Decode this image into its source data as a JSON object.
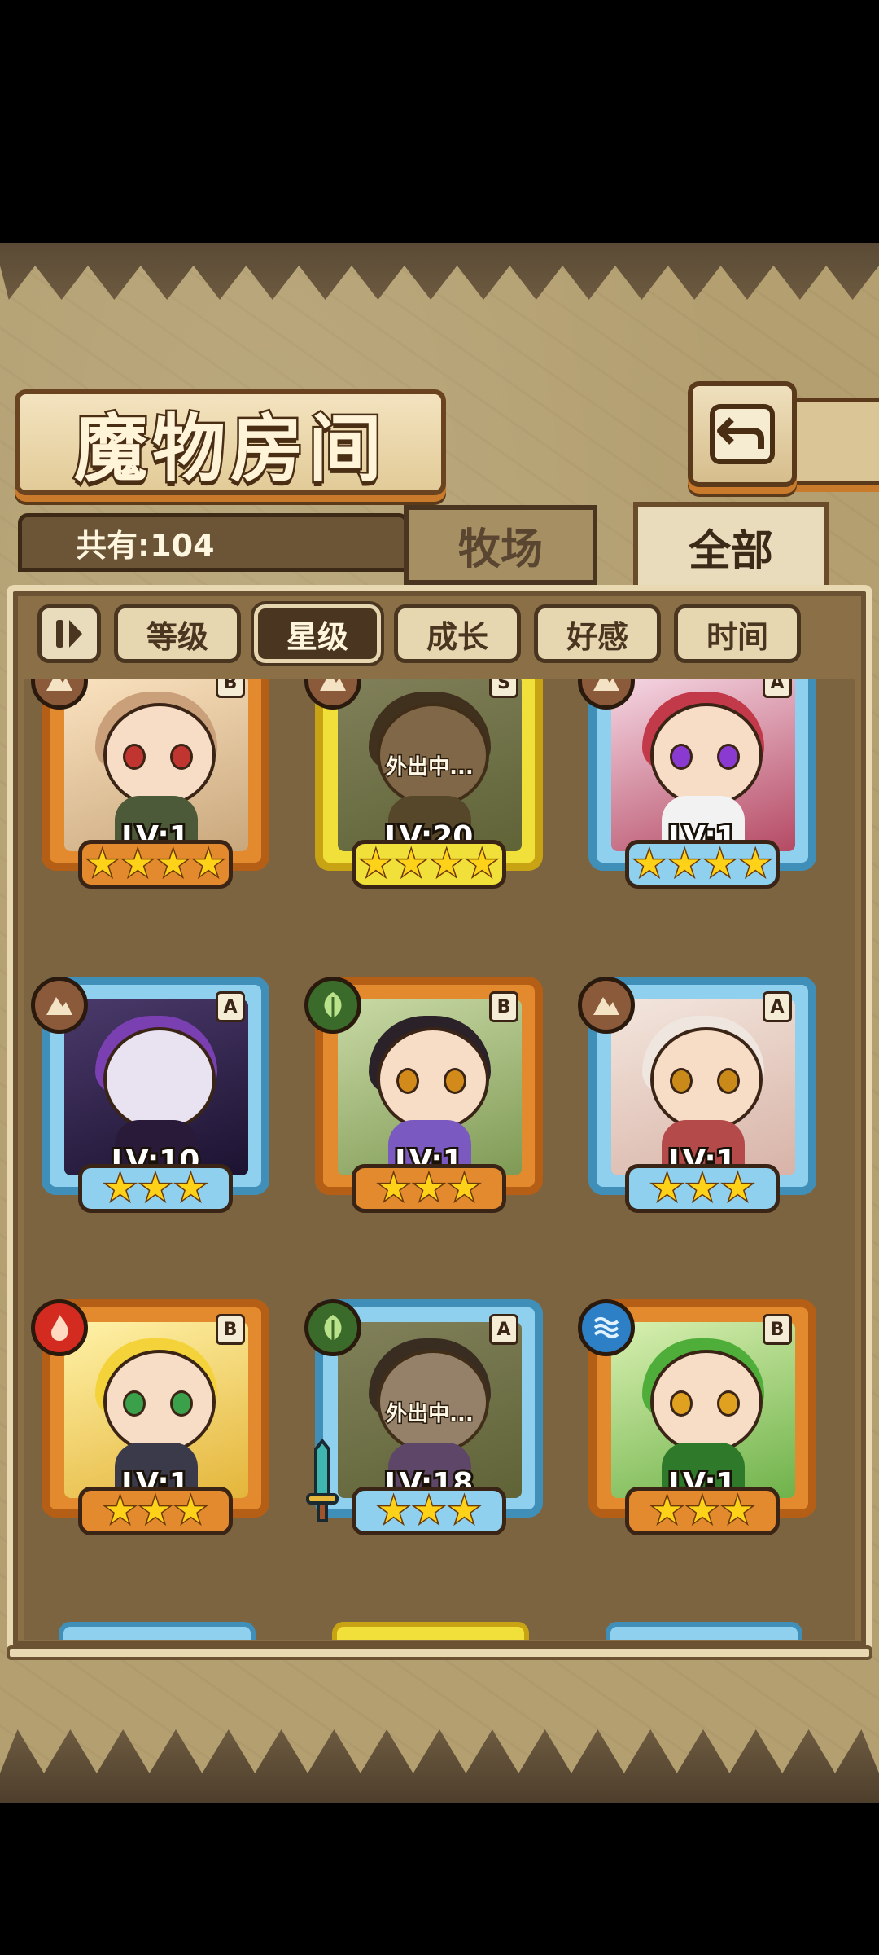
{
  "header": {
    "title": "魔物房间",
    "back_icon": "return-arrow-icon"
  },
  "summary": {
    "count_label": "共有:104"
  },
  "tabs": [
    {
      "label": "牧场",
      "active": false
    },
    {
      "label": "全部",
      "active": true
    }
  ],
  "sort": {
    "toggle_icon": "sort-order-icon",
    "options": [
      {
        "label": "等级",
        "active": false
      },
      {
        "label": "星级",
        "active": true
      },
      {
        "label": "成长",
        "active": false
      },
      {
        "label": "好感",
        "active": false
      },
      {
        "label": "时间",
        "active": false
      }
    ]
  },
  "monsters": [
    {
      "level": "LV:1",
      "rank": "B",
      "stars": 4,
      "element": "earth",
      "away": false
    },
    {
      "level": "LV:20",
      "rank": "S",
      "stars": 4,
      "element": "earth",
      "away": true,
      "away_text": "外出中..."
    },
    {
      "level": "LV:1",
      "rank": "A",
      "stars": 4,
      "element": "earth",
      "away": false
    },
    {
      "level": "LV:10",
      "rank": "A",
      "stars": 3,
      "element": "earth",
      "away": false
    },
    {
      "level": "LV:1",
      "rank": "B",
      "stars": 3,
      "element": "plant",
      "away": false
    },
    {
      "level": "LV:1",
      "rank": "A",
      "stars": 3,
      "element": "earth",
      "away": false
    },
    {
      "level": "LV:1",
      "rank": "B",
      "stars": 3,
      "element": "fire",
      "away": false
    },
    {
      "level": "LV:18",
      "rank": "A",
      "stars": 3,
      "element": "plant",
      "away": true,
      "away_text": "外出中...",
      "equipped": "sword-icon"
    },
    {
      "level": "LV:1",
      "rank": "B",
      "stars": 3,
      "element": "water",
      "away": false
    }
  ],
  "colors": {
    "rank_B": "#e48a2e",
    "rank_A": "#8fd0ee",
    "rank_S": "#f2e03a",
    "element_fire": "#d42b20",
    "element_plant": "#3a6b2a",
    "element_water": "#2d7fc6",
    "element_earth": "#8a5a3a"
  }
}
